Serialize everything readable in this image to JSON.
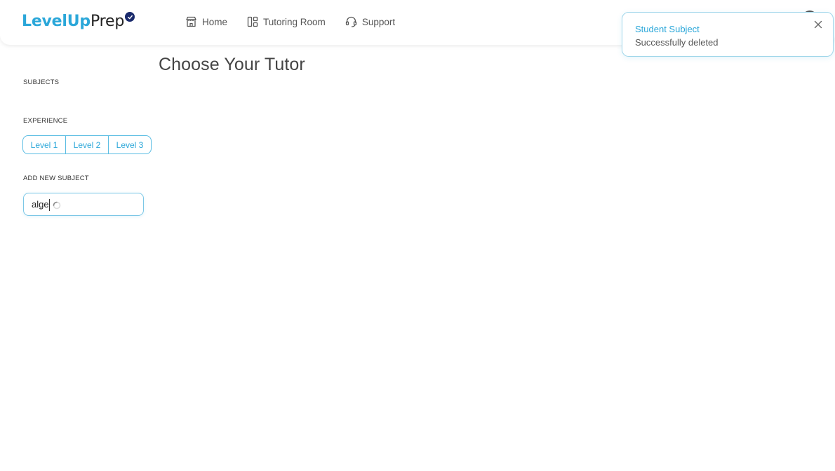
{
  "app": {
    "logo_part1": "LevelUp",
    "logo_part2": "Prep"
  },
  "nav": {
    "items": [
      {
        "label": "Home",
        "icon": "store-icon"
      },
      {
        "label": "Tutoring Room",
        "icon": "layout-icon"
      },
      {
        "label": "Support",
        "icon": "headset-icon"
      }
    ]
  },
  "toast": {
    "title": "Student Subject",
    "message": "Successfully deleted"
  },
  "main": {
    "title": "Choose Your Tutor"
  },
  "sidebar": {
    "subjects_label": "SUBJECTS",
    "experience_label": "EXPERIENCE",
    "levels": [
      "Level 1",
      "Level 2",
      "Level 3"
    ],
    "add_subject_label": "ADD NEW SUBJECT",
    "add_subject_value": "alge"
  },
  "colors": {
    "accent": "#2ba7d9",
    "badge": "#1a2a6c",
    "border": "#7cc7e6"
  }
}
